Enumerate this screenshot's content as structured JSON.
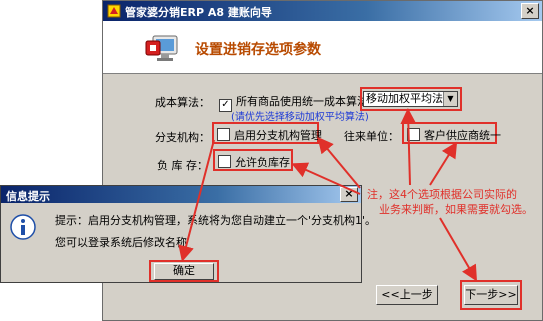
{
  "wizard": {
    "title": "管家婆分销ERP A8 建账向导",
    "close_glyph": "×",
    "header_title": "设置进销存选项参数",
    "cost_label": "成本算法：",
    "unified_cost_label": "所有商品使用统一成本算法",
    "cost_method_value": "移动加权平均法",
    "cost_hint": "(请优先选择移动加权平均算法)",
    "branch_label": "分支机构：",
    "branch_checkbox_label": "启用分支机构管理",
    "partner_label": "往来单位：",
    "partner_checkbox_label": "客户供应商统一",
    "negative_stock_label": "负 库 存：",
    "negative_stock_checkbox_label": "允许负库存",
    "note_line1": "注，这4个选项根据公司实际的",
    "note_line2": "业务来判断，如果需要就勾选。",
    "prev_button": "<<上一步",
    "next_button": "下一步>>"
  },
  "info_dialog": {
    "title": "信息提示",
    "close_glyph": "×",
    "message_line1": "提示：启用分支机构管理，系统将为您自动建立一个'分支机构1'。",
    "message_line2": "您可以登录系统后修改名称",
    "ok_button": "确定"
  },
  "colors": {
    "annotation_red": "#e0302a",
    "hint_blue": "#1f3bd6",
    "header_orange": "#b84a00",
    "titlebar_blue": "#0a246a"
  }
}
